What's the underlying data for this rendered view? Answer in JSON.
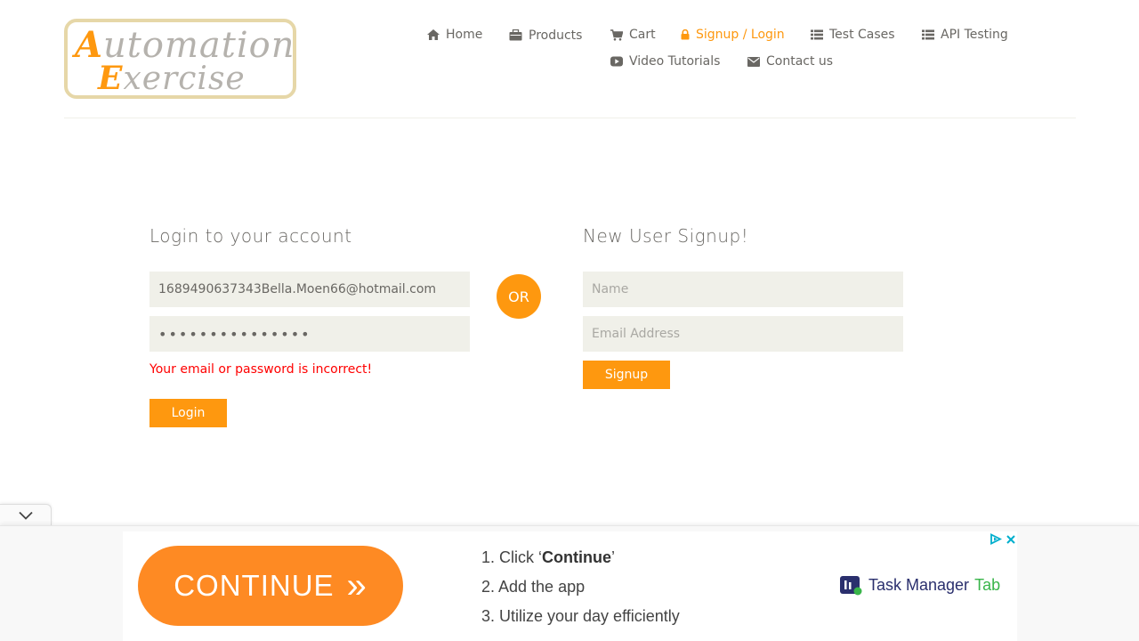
{
  "logo": {
    "line1_cap": "A",
    "line1_rest": "utomation",
    "line2_cap": "E",
    "line2_rest": "xercise"
  },
  "nav": {
    "home": "Home",
    "products": "Products",
    "cart": "Cart",
    "signup_login": "Signup / Login",
    "test_cases": "Test Cases",
    "api_testing": "API Testing",
    "video_tutorials": "Video Tutorials",
    "contact_us": "Contact us"
  },
  "login": {
    "title": "Login to your account",
    "email_value": "1689490637343Bella.Moen66@hotmail.com",
    "password_value": "•••••••••••••••",
    "error": "Your email or password is incorrect!",
    "button": "Login"
  },
  "or_label": "OR",
  "signup": {
    "title": "New User Signup!",
    "name_placeholder": "Name",
    "email_placeholder": "Email Address",
    "button": "Signup"
  },
  "ad": {
    "cta": "CONTINUE",
    "cta_glyph": "»",
    "step1_prefix": "1. Click ‘",
    "step1_bold": "Continue",
    "step1_suffix": "’",
    "step2": "2. Add the app",
    "step3": "3. Utilize your day efficiently",
    "brand_main": "Task Manager",
    "brand_tab": "Tab"
  },
  "colors": {
    "accent": "#fe980f",
    "text": "#696763",
    "input_bg": "#f0f0e9",
    "error": "#ff0000"
  }
}
